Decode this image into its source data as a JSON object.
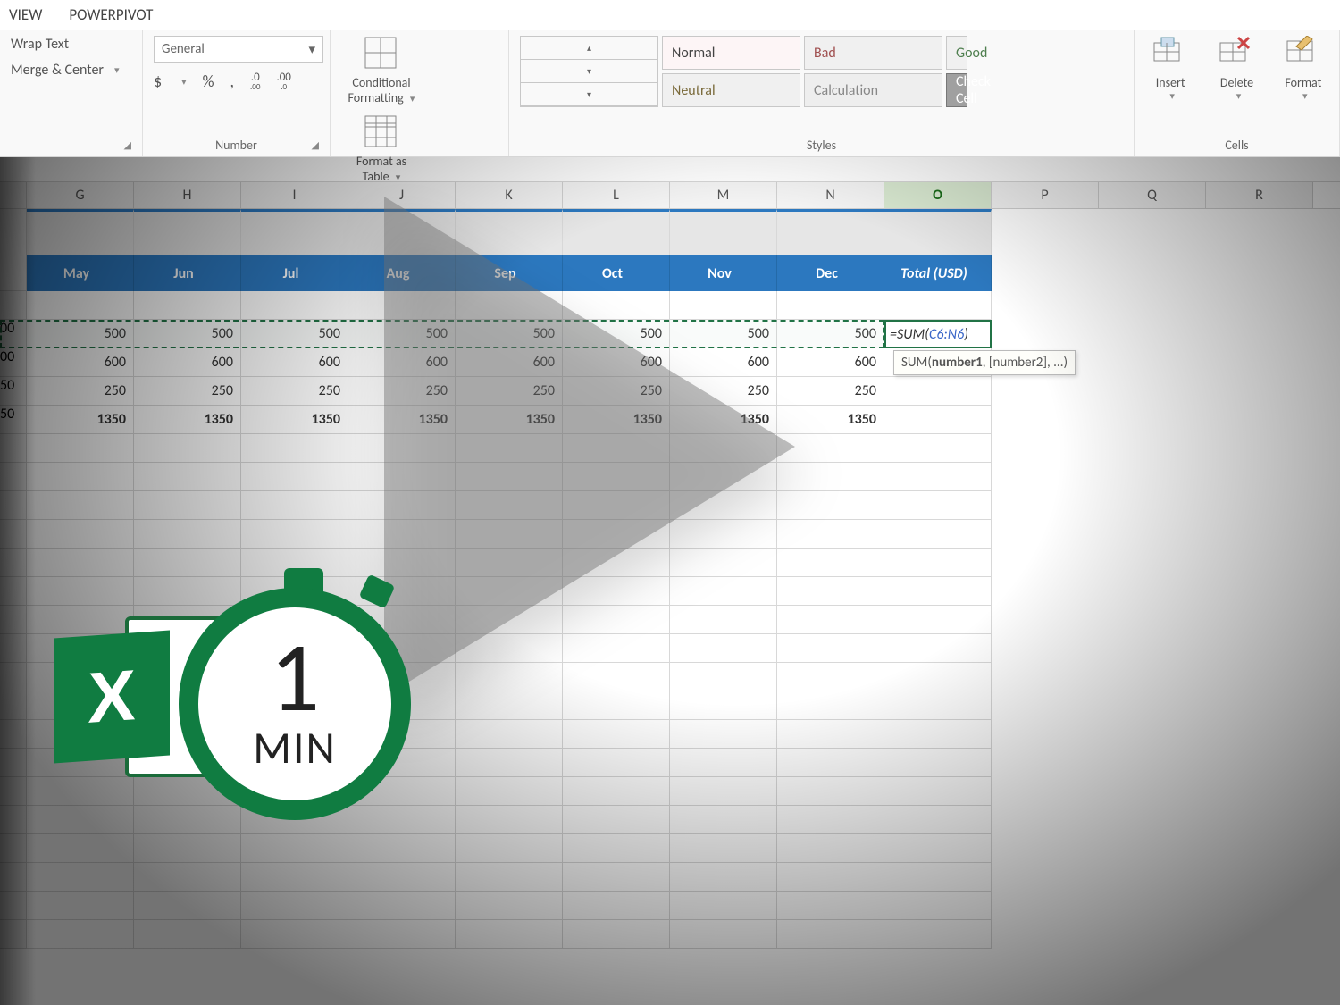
{
  "tabs": {
    "view": "VIEW",
    "powerpivot": "POWERPIVOT"
  },
  "ribbon": {
    "alignment": {
      "wrap": "Wrap Text",
      "merge": "Merge & Center"
    },
    "number": {
      "label": "Number",
      "format_combo": "General",
      "currency": "$",
      "percent": "%",
      "comma": ",",
      "inc_dec": ".0←",
      "dec_dec": ".00→"
    },
    "cond_fmt": {
      "l1": "Conditional",
      "l2": "Formatting"
    },
    "fmt_table": {
      "l1": "Format as",
      "l2": "Table"
    },
    "styles": {
      "label": "Styles",
      "normal": "Normal",
      "bad": "Bad",
      "good": "Good",
      "neutral": "Neutral",
      "calculation": "Calculation",
      "check": "Check Cell"
    },
    "cells": {
      "label": "Cells",
      "insert": "Insert",
      "delete": "Delete",
      "format": "Format"
    }
  },
  "columns": [
    "G",
    "H",
    "I",
    "J",
    "K",
    "L",
    "M",
    "N",
    "O",
    "P",
    "Q",
    "R"
  ],
  "selected_col": "O",
  "table": {
    "headers": [
      "May",
      "Jun",
      "Jul",
      "Aug",
      "Sep",
      "Oct",
      "Nov",
      "Dec",
      "Total (USD)"
    ],
    "rows": [
      {
        "lead": "00",
        "vals": [
          "500",
          "500",
          "500",
          "500",
          "500",
          "500",
          "500",
          "500"
        ]
      },
      {
        "lead": "00",
        "vals": [
          "600",
          "600",
          "600",
          "600",
          "600",
          "600",
          "600",
          "600"
        ]
      },
      {
        "lead": "50",
        "vals": [
          "250",
          "250",
          "250",
          "250",
          "250",
          "250",
          "250",
          "250"
        ]
      },
      {
        "lead": "50",
        "vals": [
          "1350",
          "1350",
          "1350",
          "1350",
          "1350",
          "1350",
          "1350",
          "1350"
        ],
        "bold": true
      }
    ]
  },
  "formula": {
    "prefix": "=SUM(",
    "ref": "C6:N6",
    "suffix": ")"
  },
  "tooltip": {
    "fn": "SUM",
    "sig_bold": "number1",
    "sig_rest": ", [number2], ...)"
  },
  "badge": {
    "x": "X",
    "num": "1",
    "min": "MIN"
  }
}
